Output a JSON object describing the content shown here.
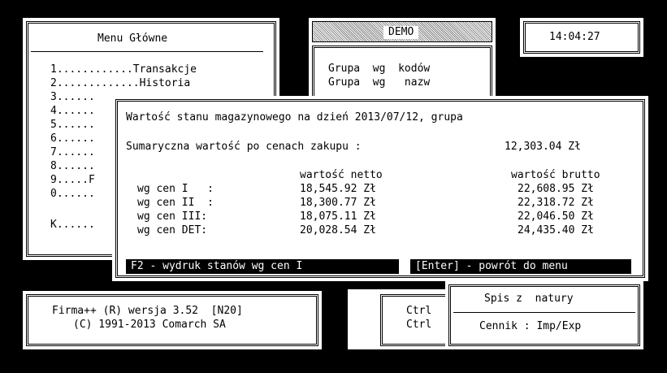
{
  "menu": {
    "title": "Menu Główne",
    "items": [
      "1............Transakcje",
      "2.............Historia",
      "3......",
      "4......",
      "5......",
      "6......",
      "7......",
      "8......",
      "9.....F",
      "0......",
      "K......"
    ]
  },
  "demo": {
    "title": "DEMO",
    "line1": "Grupa  wg  kodów",
    "line2": "Grupa  wg   nazw"
  },
  "clock": {
    "time": "14:04:27"
  },
  "dialog": {
    "title": "Wartość stanu magazynowego na dzień 2013/07/12, grupa",
    "summary_label": "Sumaryczna wartość po cenach zakupu :",
    "summary_value": "12,303.04 Zł",
    "headers": {
      "netto": "wartość netto",
      "brutto": "wartość brutto"
    },
    "rows": [
      {
        "label": "wg cen I   :",
        "netto": "18,545.92 Zł",
        "brutto": "22,608.95 Zł"
      },
      {
        "label": "wg cen II  :",
        "netto": "18,300.77 Zł",
        "brutto": "22,318.72 Zł"
      },
      {
        "label": "wg cen III:",
        "netto": "18,075.11 Zł",
        "brutto": "22,046.50 Zł"
      },
      {
        "label": "wg cen DET:",
        "netto": "20,028.54 Zł",
        "brutto": "24,435.40 Zł"
      }
    ],
    "buttons": {
      "print": "F2 - wydruk stanów wg cen I",
      "back": "[Enter] - powrót do menu"
    }
  },
  "firma": {
    "line1": "Firma++ (R) wersja 3.52  [N20]",
    "line2": "(C) 1991-2013 Comarch SA"
  },
  "ctrl": {
    "line1": "Ctrl",
    "line2": "Ctrl"
  },
  "spis": {
    "label": "Spis z  natury"
  },
  "cennik": {
    "label": "Cennik : Imp/Exp"
  }
}
